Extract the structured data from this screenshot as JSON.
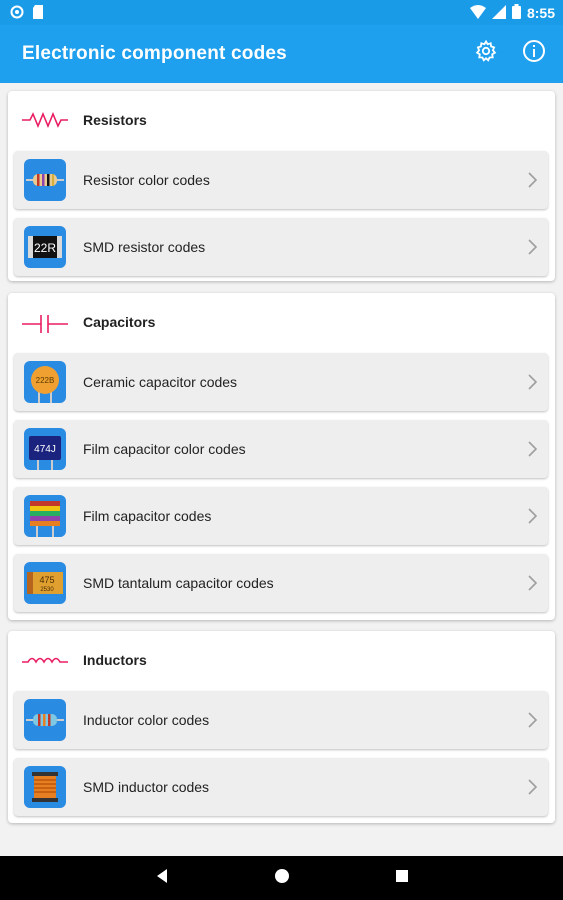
{
  "status_bar": {
    "time": "8:55"
  },
  "app_bar": {
    "title": "Electronic component codes"
  },
  "sections": [
    {
      "title": "Resistors",
      "items": [
        {
          "label": "Resistor color codes",
          "icon": "resistor-color-icon"
        },
        {
          "label": "SMD resistor codes",
          "icon": "smd-resistor-icon",
          "thumb_text": "22R"
        }
      ]
    },
    {
      "title": "Capacitors",
      "items": [
        {
          "label": "Ceramic capacitor codes",
          "icon": "ceramic-capacitor-icon",
          "thumb_text": "222B"
        },
        {
          "label": "Film capacitor color codes",
          "icon": "film-capacitor-color-icon",
          "thumb_text": "474J"
        },
        {
          "label": "Film capacitor codes",
          "icon": "film-capacitor-icon"
        },
        {
          "label": "SMD tantalum capacitor codes",
          "icon": "smd-tantalum-icon",
          "thumb_text": "475",
          "thumb_text2": "2530"
        }
      ]
    },
    {
      "title": "Inductors",
      "items": [
        {
          "label": "Inductor color codes",
          "icon": "inductor-color-icon"
        },
        {
          "label": "SMD inductor codes",
          "icon": "smd-inductor-icon"
        }
      ]
    }
  ],
  "colors": {
    "status_bar": "#1a9be8",
    "app_bar": "#1ea0ef",
    "accent_symbol": "#e91e63",
    "thumb_bg": "#2a8be3"
  }
}
